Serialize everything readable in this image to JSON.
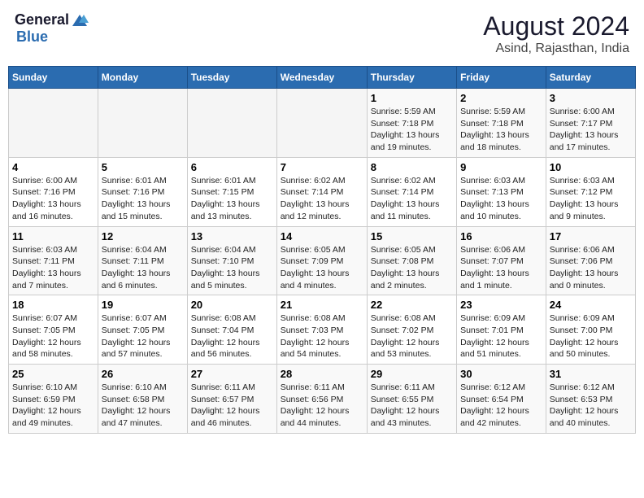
{
  "logo": {
    "general": "General",
    "blue": "Blue"
  },
  "title": "August 2024",
  "subtitle": "Asind, Rajasthan, India",
  "weekdays": [
    "Sunday",
    "Monday",
    "Tuesday",
    "Wednesday",
    "Thursday",
    "Friday",
    "Saturday"
  ],
  "weeks": [
    [
      {
        "day": "",
        "info": ""
      },
      {
        "day": "",
        "info": ""
      },
      {
        "day": "",
        "info": ""
      },
      {
        "day": "",
        "info": ""
      },
      {
        "day": "1",
        "info": "Sunrise: 5:59 AM\nSunset: 7:18 PM\nDaylight: 13 hours and 19 minutes."
      },
      {
        "day": "2",
        "info": "Sunrise: 5:59 AM\nSunset: 7:18 PM\nDaylight: 13 hours and 18 minutes."
      },
      {
        "day": "3",
        "info": "Sunrise: 6:00 AM\nSunset: 7:17 PM\nDaylight: 13 hours and 17 minutes."
      }
    ],
    [
      {
        "day": "4",
        "info": "Sunrise: 6:00 AM\nSunset: 7:16 PM\nDaylight: 13 hours and 16 minutes."
      },
      {
        "day": "5",
        "info": "Sunrise: 6:01 AM\nSunset: 7:16 PM\nDaylight: 13 hours and 15 minutes."
      },
      {
        "day": "6",
        "info": "Sunrise: 6:01 AM\nSunset: 7:15 PM\nDaylight: 13 hours and 13 minutes."
      },
      {
        "day": "7",
        "info": "Sunrise: 6:02 AM\nSunset: 7:14 PM\nDaylight: 13 hours and 12 minutes."
      },
      {
        "day": "8",
        "info": "Sunrise: 6:02 AM\nSunset: 7:14 PM\nDaylight: 13 hours and 11 minutes."
      },
      {
        "day": "9",
        "info": "Sunrise: 6:03 AM\nSunset: 7:13 PM\nDaylight: 13 hours and 10 minutes."
      },
      {
        "day": "10",
        "info": "Sunrise: 6:03 AM\nSunset: 7:12 PM\nDaylight: 13 hours and 9 minutes."
      }
    ],
    [
      {
        "day": "11",
        "info": "Sunrise: 6:03 AM\nSunset: 7:11 PM\nDaylight: 13 hours and 7 minutes."
      },
      {
        "day": "12",
        "info": "Sunrise: 6:04 AM\nSunset: 7:11 PM\nDaylight: 13 hours and 6 minutes."
      },
      {
        "day": "13",
        "info": "Sunrise: 6:04 AM\nSunset: 7:10 PM\nDaylight: 13 hours and 5 minutes."
      },
      {
        "day": "14",
        "info": "Sunrise: 6:05 AM\nSunset: 7:09 PM\nDaylight: 13 hours and 4 minutes."
      },
      {
        "day": "15",
        "info": "Sunrise: 6:05 AM\nSunset: 7:08 PM\nDaylight: 13 hours and 2 minutes."
      },
      {
        "day": "16",
        "info": "Sunrise: 6:06 AM\nSunset: 7:07 PM\nDaylight: 13 hours and 1 minute."
      },
      {
        "day": "17",
        "info": "Sunrise: 6:06 AM\nSunset: 7:06 PM\nDaylight: 13 hours and 0 minutes."
      }
    ],
    [
      {
        "day": "18",
        "info": "Sunrise: 6:07 AM\nSunset: 7:05 PM\nDaylight: 12 hours and 58 minutes."
      },
      {
        "day": "19",
        "info": "Sunrise: 6:07 AM\nSunset: 7:05 PM\nDaylight: 12 hours and 57 minutes."
      },
      {
        "day": "20",
        "info": "Sunrise: 6:08 AM\nSunset: 7:04 PM\nDaylight: 12 hours and 56 minutes."
      },
      {
        "day": "21",
        "info": "Sunrise: 6:08 AM\nSunset: 7:03 PM\nDaylight: 12 hours and 54 minutes."
      },
      {
        "day": "22",
        "info": "Sunrise: 6:08 AM\nSunset: 7:02 PM\nDaylight: 12 hours and 53 minutes."
      },
      {
        "day": "23",
        "info": "Sunrise: 6:09 AM\nSunset: 7:01 PM\nDaylight: 12 hours and 51 minutes."
      },
      {
        "day": "24",
        "info": "Sunrise: 6:09 AM\nSunset: 7:00 PM\nDaylight: 12 hours and 50 minutes."
      }
    ],
    [
      {
        "day": "25",
        "info": "Sunrise: 6:10 AM\nSunset: 6:59 PM\nDaylight: 12 hours and 49 minutes."
      },
      {
        "day": "26",
        "info": "Sunrise: 6:10 AM\nSunset: 6:58 PM\nDaylight: 12 hours and 47 minutes."
      },
      {
        "day": "27",
        "info": "Sunrise: 6:11 AM\nSunset: 6:57 PM\nDaylight: 12 hours and 46 minutes."
      },
      {
        "day": "28",
        "info": "Sunrise: 6:11 AM\nSunset: 6:56 PM\nDaylight: 12 hours and 44 minutes."
      },
      {
        "day": "29",
        "info": "Sunrise: 6:11 AM\nSunset: 6:55 PM\nDaylight: 12 hours and 43 minutes."
      },
      {
        "day": "30",
        "info": "Sunrise: 6:12 AM\nSunset: 6:54 PM\nDaylight: 12 hours and 42 minutes."
      },
      {
        "day": "31",
        "info": "Sunrise: 6:12 AM\nSunset: 6:53 PM\nDaylight: 12 hours and 40 minutes."
      }
    ]
  ]
}
